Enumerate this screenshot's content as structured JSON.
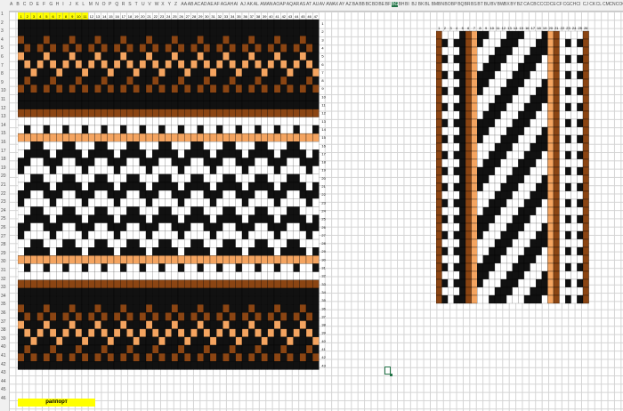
{
  "spreadsheet": {
    "columns": [
      "A",
      "B",
      "C",
      "D",
      "E",
      "F",
      "G",
      "H",
      "I",
      "J",
      "K",
      "L",
      "M",
      "N",
      "O",
      "P",
      "Q",
      "R",
      "S",
      "T",
      "U",
      "V",
      "W",
      "X",
      "Y",
      "Z",
      "AA",
      "AB",
      "AC",
      "AD",
      "AE",
      "AF",
      "AG",
      "AH",
      "AI",
      "AJ",
      "AK",
      "AL",
      "AM",
      "AN",
      "AO",
      "AP",
      "AQ",
      "AR",
      "AS",
      "AT",
      "AU",
      "AV",
      "AW",
      "AX",
      "AY",
      "AZ",
      "BA",
      "BB",
      "BC",
      "BD",
      "BE",
      "BF",
      "BG",
      "BH",
      "BI",
      "BJ",
      "BK",
      "BL",
      "BM",
      "BN",
      "BO",
      "BP",
      "BQ",
      "BR",
      "BS",
      "BT",
      "BU",
      "BV",
      "BW",
      "BX",
      "BY",
      "BZ",
      "CA",
      "CB",
      "CC",
      "CD",
      "CE",
      "CF",
      "CG",
      "CH",
      "CI",
      "CJ",
      "CK",
      "CL",
      "CM",
      "CN",
      "CO",
      "CP",
      "CQ",
      "CR"
    ],
    "selected_column": "BG",
    "row_count": 46,
    "rapport_label": "раппорт"
  },
  "palette": {
    "black": "#111111",
    "white": "#ffffff",
    "brown": "#8b4513",
    "orange": "#f4a460",
    "header_yellow": "#ffff00",
    "selection_green": "#217346"
  },
  "main_chart": {
    "columns": 47,
    "rows": 46,
    "top_numbers_highlighted": [
      1,
      2,
      3,
      4,
      5,
      6,
      7,
      8,
      9,
      10,
      11
    ],
    "rows_spec": [
      "K",
      "K",
      "BKKKBKKKBKKKBKKKBKKKBKKKBKKKBKKKBKKKBKKKBKKKBKK",
      "KBKBKBKBKBKBKBKBKBKBKBKBKBKBKBKBKBKBKBKBKBKBKBK",
      "OKKKOKKKOKKKOKKKOKKKOKKKOKKKOKKKOKKKOKKKOKKKOKK",
      "KOKOKOKOKOKOKOKOKOKOKOKOKOKOKOKOKOKOKOKOKOKOKOK",
      "KKOKKKOKKKOKKKOKKKOKKKOKKKOKKKOKKKOKKKOKKKOKKKO",
      "KBKKKBKKKBKKKBKKKBKKKBKKKBKKKBKKKBKKKBKKKBKKKBK",
      "BKBKBKBKBKBKBKBKBKBKBKBKBKBKBKBKBKBKBKBKBKBKBKB",
      "K",
      "K",
      "B",
      "W",
      "WKWWKWWKWWKWWKWWKWWKWWKWWKWWKWWKWWKWWKWWKWWKWWK",
      "O",
      "WWKKWWWKKWWWKKWWWKKWWWKKWWWKKWWWKKWWWKKWWWKKWWW",
      "WKKKKWKKKKWKKKKWKKKKWKKKKWKKKKWKKKKWKKKKWKKKKWK",
      "KKWWKKKWWKKKWWKKKWWKKKWWKKKWWKKKWWKKKWWKKKWWKKK",
      "KWWWWKWWWWKWWWWKWWWWKWWWWKWWWWKWWWWKWWWWKWWWWKW",
      "WWKKWWWKKWWWKKWWWKKWWWKKWWWKKWWWKKWWWKKWWWKKWWW",
      "WKKKKWKKKKWKKKKWKKKKWKKKKWKKKKWKKKKWKKKKWKKKKWK",
      "KKWWKKKWWKKKWWKKKWWKKKWWKKKWWKKKWWKKKWWKKKWWKKK",
      "KWWWWKWWWWKWWWWKWWWWKWWWWKWWWWKWWWWKWWWWKWWWWKW",
      "WWKKWWWKKWWWKKWWWKKWWWKKWWWKKWWWKKWWWKKWWWKKWWW",
      "WKKKKWKKKKWKKKKWKKKKWKKKKWKKKKWKKKKWKKKKWKKKKWK",
      "KKWWKKKWWKKKWWKKKWWKKKWWKKKWWKKKWWKKKWWKKKWWKKK",
      "KWWWWKWWWWKWWWWKWWWWKWWWWKWWWWKWWWWKWWWWKWWWWKW",
      "WWKKWWWKKWWWKKWWWKKWWWKKWWWKKWWWKKWWWKKWWWKKWWW",
      "WKKKKWKKKKWKKKKWKKKKWKKKKWKKKKWKKKKWKKKKWKKKKWK",
      "O",
      "WKWWKWWKWWKWWKWWKWWKWWKWWKWWKWWKWWKWWKWWKWWKWWK",
      "W",
      "B",
      "K",
      "K",
      "BKKKBKKKBKKKBKKKBKKKBKKKBKKKBKKKBKKKBKKKBKKKBKK",
      "KBKBKBKBKBKBKBKBKBKBKBKBKBKBKBKBKBKBKBKBKBKBKBK",
      "OKKKOKKKOKKKOKKKOKKKOKKKOKKKOKKKOKKKOKKKOKKKOKK",
      "KOKOKOKOKOKOKOKOKOKOKOKOKOKOKOKOKOKOKOKOKOKOKOK",
      "KKOKKKOKKKOKKKOKKKOKKKOKKKOKKKOKKKOKKKOKKKOKKKO",
      "KBKKKBKKKBKKKBKKKBKKKBKKKBKKKBKKKBKKKBKKKBKKKBK",
      "BKBKBKBKBKBKBKBKBKBKBKBKBKBKBKBKBKBKBKBKBKBKBKB",
      "K"
    ]
  },
  "side_chart": {
    "columns": 26,
    "rows": 34,
    "top_numbers": [
      "1",
      "2",
      "3",
      "4",
      "5",
      "6",
      "7",
      "8",
      "9",
      "10",
      "11",
      "12",
      "13",
      "14",
      "15",
      "16",
      "17",
      "18",
      "19",
      "20",
      "21",
      "22",
      "23",
      "24",
      "25",
      "26"
    ],
    "column_colors": [
      "B",
      "W",
      "W",
      "W",
      "K",
      "B",
      "O",
      "W",
      "K",
      "W",
      "W",
      "K",
      "W",
      "K",
      "W",
      "W",
      "K",
      "K",
      "W",
      "O",
      "B",
      "W",
      "K",
      "W",
      "K",
      "B"
    ]
  }
}
